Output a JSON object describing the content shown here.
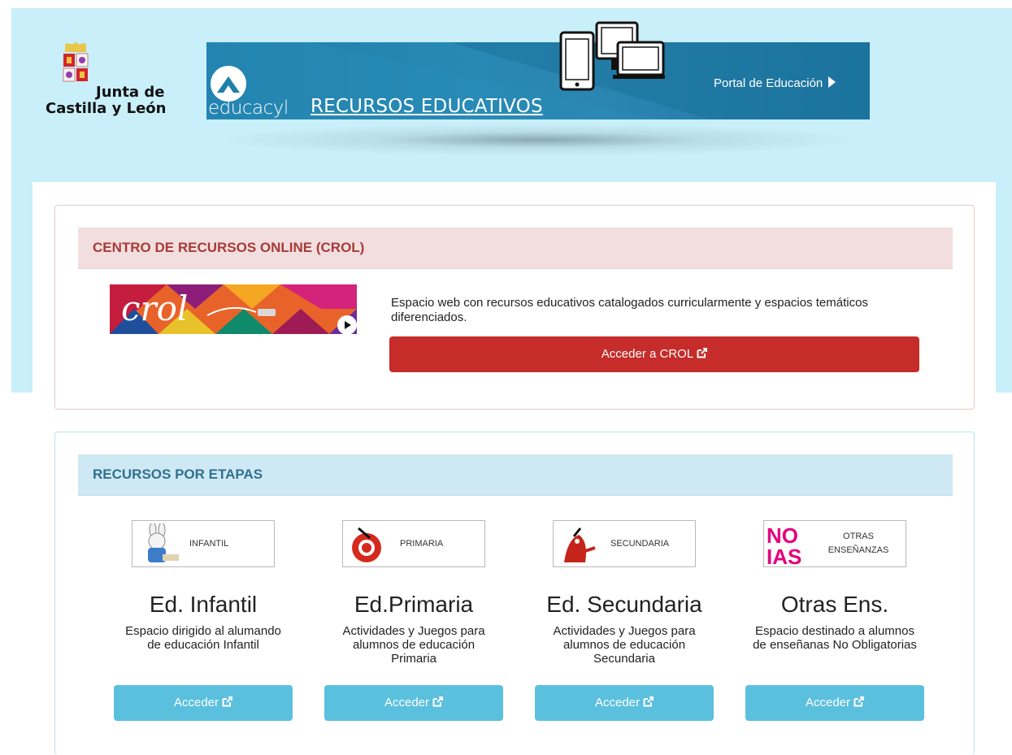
{
  "header": {
    "org_line1": "Junta de",
    "org_line2": "Castilla y León",
    "brand": "educacyl",
    "section_title": "RECURSOS EDUCATIVOS",
    "portal_link": "Portal de Educación"
  },
  "crol": {
    "title": "CENTRO DE RECURSOS ONLINE (CROL)",
    "description": "Espacio web con recursos educativos catalogados curricularmente y espacios temáticos diferenciados.",
    "button_label": "Acceder a CROL",
    "image_text": "crol"
  },
  "etapas": {
    "title": "RECURSOS POR ETAPAS",
    "items": [
      {
        "thumb_label": "INFANTIL",
        "title": "Ed. Infantil",
        "description": "Espacio dirigido al alumando de educación Infantil",
        "button_label": "Acceder"
      },
      {
        "thumb_label": "PRIMARIA",
        "title": "Ed.Primaria",
        "description": "Actividades y Juegos para alumnos de educación Primaria",
        "button_label": "Acceder"
      },
      {
        "thumb_label": "SECUNDARIA",
        "title": "Ed. Secundaria",
        "description": "Actividades y Juegos para alumnos de educación Secundaria",
        "button_label": "Acceder"
      },
      {
        "thumb_label": "OTRAS ENSEÑANZAS",
        "title": "Otras Ens.",
        "description": "Espacio destinado a alumnos de enseñanas No Obligatorias",
        "button_label": "Acceder"
      }
    ],
    "noias_top": "NO",
    "noias_bottom": "IAS"
  },
  "colors": {
    "hero_bg": "#c8effa",
    "crol_accent": "#c52c2a",
    "etapas_button": "#5bc0de",
    "banner_blue": "#2789b4"
  },
  "icons": [
    "jcyl-crest-icon",
    "educacyl-logo-icon",
    "devices-icon",
    "chevron-right-icon",
    "external-link-icon",
    "play-icon"
  ]
}
